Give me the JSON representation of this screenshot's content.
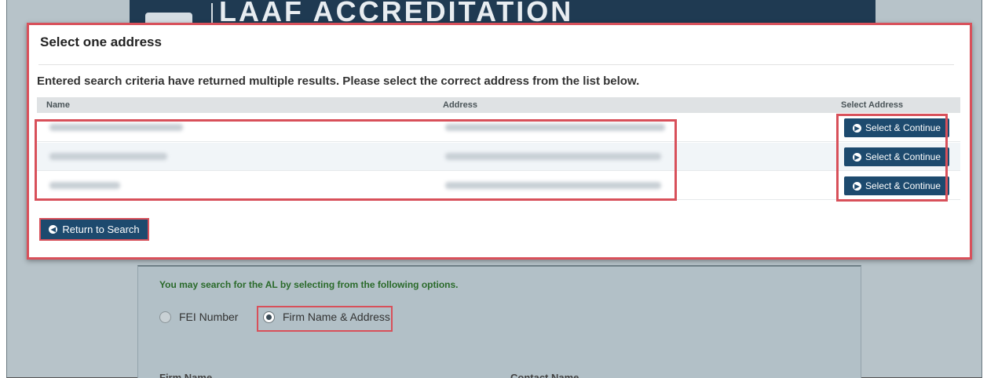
{
  "background": {
    "header_title": "LAAF ACCREDITATION",
    "hint": "You may search for the AL by selecting from the following options.",
    "radios": [
      {
        "label": "FEI Number",
        "checked": false
      },
      {
        "label": "Firm Name & Address",
        "checked": true
      }
    ],
    "cut_labels": [
      "Firm Name",
      "Contact Name"
    ]
  },
  "modal": {
    "title": "Select one address",
    "message": "Entered search criteria have returned multiple results. Please select the correct address from the list below.",
    "columns": {
      "name": "Name",
      "address": "Address",
      "select": "Select Address"
    },
    "rows": [
      {
        "select_label": "Select & Continue"
      },
      {
        "select_label": "Select & Continue"
      },
      {
        "select_label": "Select & Continue"
      }
    ],
    "return_label": "Return to Search"
  },
  "colors": {
    "accent": "#1d4a6e",
    "highlight": "#d8505a",
    "hint_green": "#2a6a2a"
  },
  "icons": {
    "select_button": "circle-arrow-right-icon",
    "return_button": "circle-arrow-left-icon"
  }
}
